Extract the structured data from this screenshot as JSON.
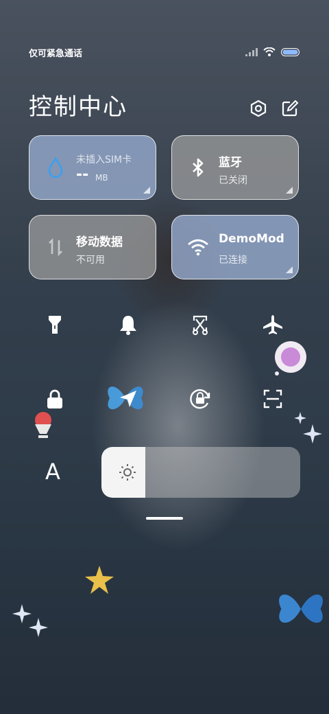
{
  "status": {
    "carrier_text": "仅可紧急通话",
    "battery_color": "#8fb9ff"
  },
  "header": {
    "title": "控制中心",
    "settings_icon": "gear-icon",
    "edit_icon": "edit-icon"
  },
  "tiles": [
    {
      "name": "tile-data-usage",
      "icon": "water-drop-icon",
      "label": "未插入SIM卡",
      "value": "--",
      "unit": "MB",
      "style": "blue"
    },
    {
      "name": "tile-bluetooth",
      "icon": "bluetooth-icon",
      "label": "蓝牙",
      "sub": "已关闭",
      "style": "grey"
    },
    {
      "name": "tile-mobile-data",
      "icon": "mobile-data-icon",
      "label": "移动数据",
      "sub": "不可用",
      "style": "grey"
    },
    {
      "name": "tile-wifi",
      "icon": "wifi-icon",
      "label": "DemoMod",
      "sub": "已连接",
      "style": "blue"
    }
  ],
  "quick_toggles": [
    "flashlight-icon",
    "bell-icon",
    "screenshot-icon",
    "airplane-icon",
    "lock-icon",
    "location-icon",
    "rotation-lock-icon",
    "scan-icon"
  ],
  "brightness": {
    "level": 0.22,
    "auto_label": "A"
  },
  "colors": {
    "tile_blue": "#96aacd",
    "tile_grey": "#a0a0a0"
  }
}
